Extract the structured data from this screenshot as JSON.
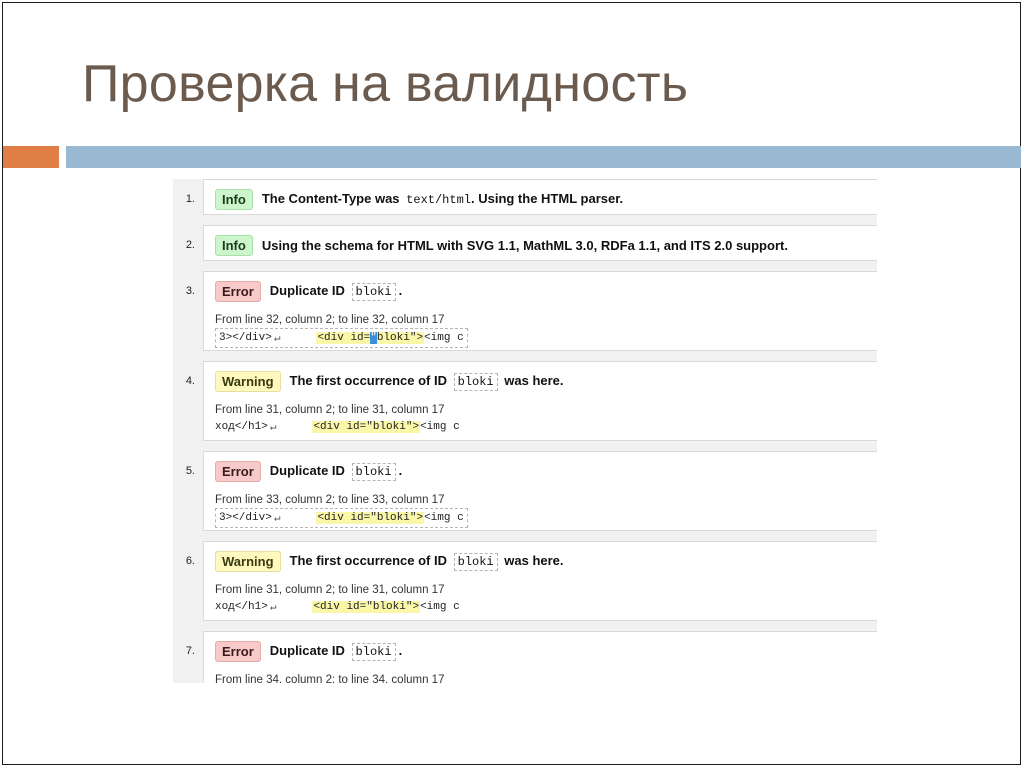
{
  "slide": {
    "title": "Проверка на валидность",
    "colors": {
      "title": "#6b5a4e",
      "accent_orange": "#e07f45",
      "accent_blue": "#99b9d3"
    }
  },
  "messages": [
    {
      "num": "1.",
      "type": "Info",
      "text": "The Content-Type was",
      "code": "text/html",
      "after": ". Using the HTML parser."
    },
    {
      "num": "2.",
      "type": "Info",
      "text": "Using the schema for HTML with SVG 1.1, MathML 3.0, RDFa 1.1, and ITS 2.0 support."
    },
    {
      "num": "3.",
      "type": "Error",
      "text": "Duplicate ID",
      "code": "bloki",
      "after": ".",
      "location": "From line 32, column 2; to line 32, column 17",
      "extract_pre": "3></div>",
      "extract_nl": "↵",
      "hl_1": "<div id=",
      "caret": "\"",
      "hl_2": "bloki\">",
      "extract_post": "<img c"
    },
    {
      "num": "4.",
      "type": "Warning",
      "text": "The first occurrence of ID",
      "code": "bloki",
      "after": "was here.",
      "location": "From line 31, column 2; to line 31, column 17",
      "extract_pre": "ход</h1>",
      "extract_nl": "↵",
      "hl": "<div id=\"bloki\">",
      "extract_post": "<img c"
    },
    {
      "num": "5.",
      "type": "Error",
      "text": "Duplicate ID",
      "code": "bloki",
      "after": ".",
      "location": "From line 33, column 2; to line 33, column 17",
      "extract_pre": "3></div>",
      "extract_nl": "↵",
      "hl": "<div id=\"bloki\">",
      "extract_post": "<img c"
    },
    {
      "num": "6.",
      "type": "Warning",
      "text": "The first occurrence of ID",
      "code": "bloki",
      "after": "was here.",
      "location": "From line 31, column 2; to line 31, column 17",
      "extract_pre": "ход</h1>",
      "extract_nl": "↵",
      "hl": "<div id=\"bloki\">",
      "extract_post": "<img c"
    },
    {
      "num": "7.",
      "type": "Error",
      "text": "Duplicate ID",
      "code": "bloki",
      "after": ".",
      "location": "From line 34, column 2; to line 34, column 17"
    }
  ]
}
